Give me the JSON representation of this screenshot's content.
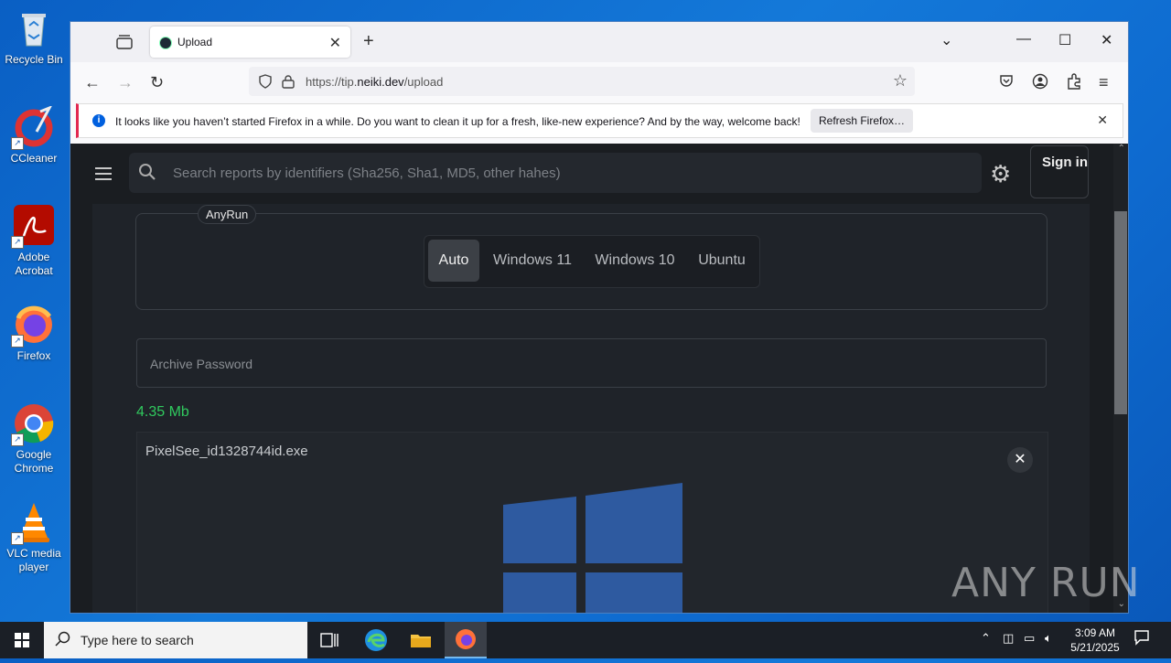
{
  "desktop": {
    "icons": [
      {
        "label": "Recycle Bin"
      },
      {
        "label": "CCleaner"
      },
      {
        "label": "Adobe Acrobat"
      },
      {
        "label": "Firefox"
      },
      {
        "label": "Google Chrome"
      },
      {
        "label": "VLC media player"
      }
    ]
  },
  "browser": {
    "tab_title": "Upload",
    "url_prefix": "https://tip.",
    "url_domain": "neiki.dev",
    "url_path": "/upload",
    "notification": {
      "message": "It looks like you haven’t started Firefox in a while. Do you want to clean it up for a fresh, like-new experience? And by the way, welcome back!",
      "button": "Refresh Firefox…"
    }
  },
  "page": {
    "search_placeholder": "Search reports by identifiers (Sha256, Sha1, MD5, other hahes)",
    "sign_in": "Sign in",
    "anyrun_label": "AnyRun",
    "os_options": [
      {
        "label": "Auto",
        "active": true
      },
      {
        "label": "Windows 11",
        "active": false
      },
      {
        "label": "Windows 10",
        "active": false
      },
      {
        "label": "Ubuntu",
        "active": false
      }
    ],
    "password_placeholder": "Archive Password",
    "file_size": "4.35 Mb",
    "file_name": "PixelSee_id1328744id.exe"
  },
  "watermark": "ANY RUN",
  "taskbar": {
    "search_placeholder": "Type here to search",
    "time": "3:09 AM",
    "date": "5/21/2025"
  },
  "colors": {
    "accent_green": "#30c95e",
    "page_bg": "#1a1d21",
    "windows_logo": "#2e5aa0"
  }
}
